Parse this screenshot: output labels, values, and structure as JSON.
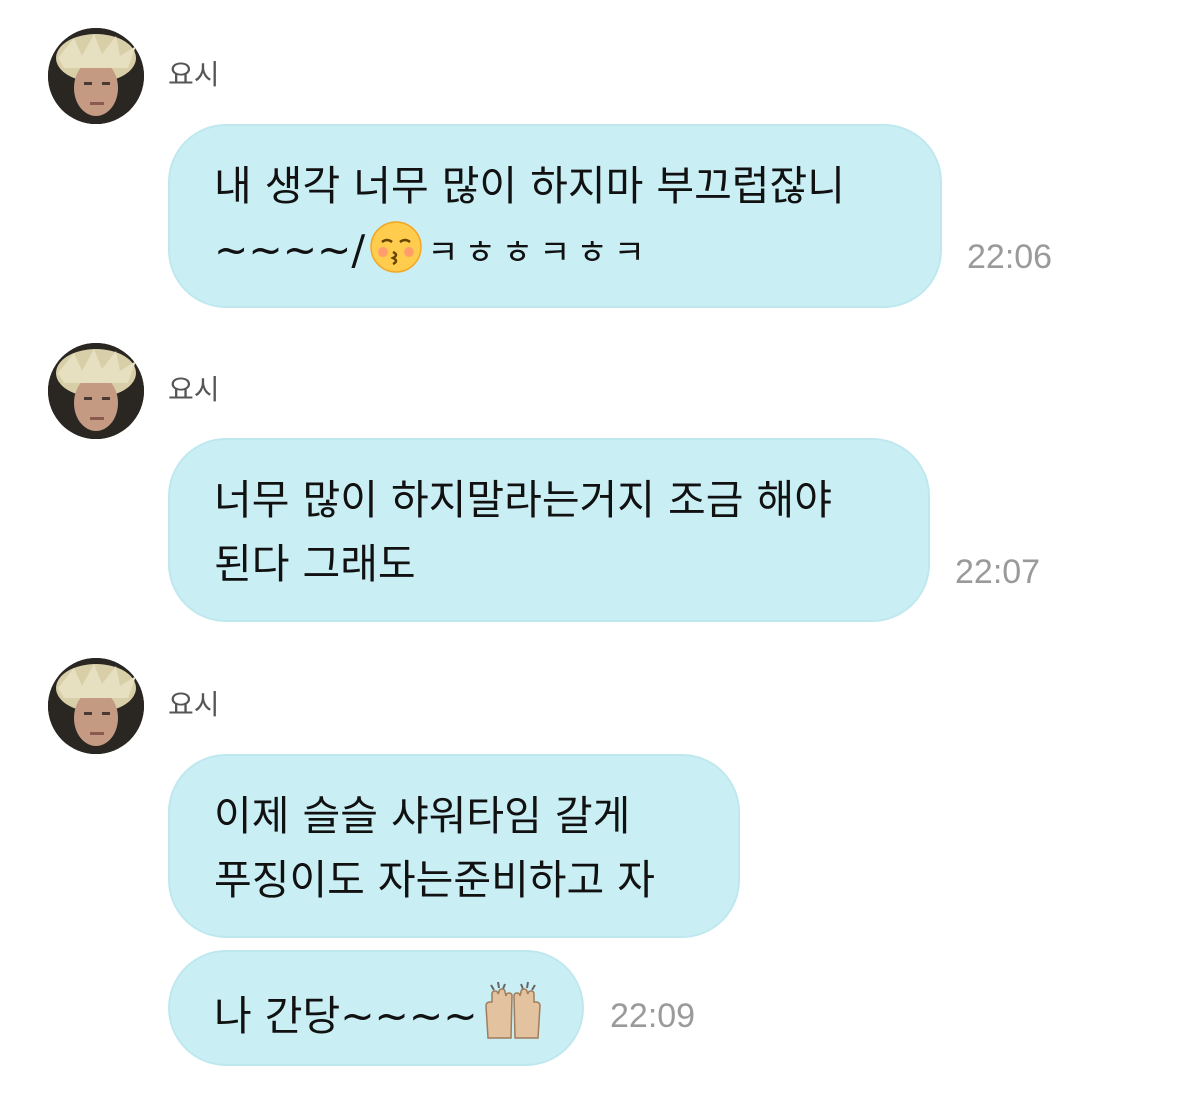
{
  "messages": [
    {
      "sender": "요시",
      "lines": [
        "내 생각 너무 많이 하지마 부끄럽잖니",
        "~~~~/",
        "ㅋㅎㅎㅋㅎㅋ"
      ],
      "time": "22:06"
    },
    {
      "sender": "요시",
      "lines": [
        "너무 많이 하지말라는거지 조금 해야",
        "된다 그래도"
      ],
      "time": "22:07"
    },
    {
      "sender": "요시",
      "lines": [
        "이제 슬슬 샤워타임 갈게",
        "푸징이도 자는준비하고 자"
      ],
      "time": ""
    },
    {
      "sender": "",
      "lines": [
        "나 간당~~~~"
      ],
      "time": "22:09"
    }
  ],
  "icons": {
    "avatar": "profile-photo",
    "kiss_emoji": "kissing-face-with-closed-eyes",
    "hands_emoji": "raising-hands"
  },
  "colors": {
    "bubble": "#c9eff5",
    "time": "#9a9a9a",
    "sender": "#555555"
  }
}
